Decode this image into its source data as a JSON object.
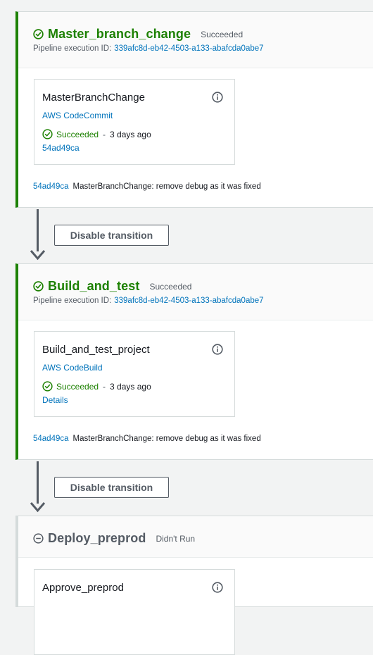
{
  "stages": [
    {
      "name": "Master_branch_change",
      "status": "Succeeded",
      "exec_label": "Pipeline execution ID:",
      "exec_id": "339afc8d-eb42-4503-a133-abafcda0abe7",
      "action": {
        "name": "MasterBranchChange",
        "provider": "AWS CodeCommit",
        "status": "Succeeded",
        "separator": "-",
        "ago": "3 days ago",
        "link": "54ad49ca"
      },
      "commit_id": "54ad49ca",
      "commit_msg": "MasterBranchChange: remove debug as it was fixed"
    },
    {
      "name": "Build_and_test",
      "status": "Succeeded",
      "exec_label": "Pipeline execution ID:",
      "exec_id": "339afc8d-eb42-4503-a133-abafcda0abe7",
      "action": {
        "name": "Build_and_test_project",
        "provider": "AWS CodeBuild",
        "status": "Succeeded",
        "separator": "-",
        "ago": "3 days ago",
        "link": "Details"
      },
      "commit_id": "54ad49ca",
      "commit_msg": "MasterBranchChange: remove debug as it was fixed"
    },
    {
      "name": "Deploy_preprod",
      "status": "Didn't Run",
      "action": {
        "name": "Approve_preprod"
      }
    }
  ],
  "transitions": [
    {
      "label": "Disable transition"
    },
    {
      "label": "Disable transition"
    }
  ],
  "icons": {
    "success": "check-circle-icon",
    "not_run": "minus-circle-icon",
    "info": "info-icon",
    "arrow": "arrow-down-icon"
  },
  "colors": {
    "success": "#1d8102",
    "link": "#0073bb",
    "muted": "#545b64",
    "background": "#f2f3f3"
  }
}
